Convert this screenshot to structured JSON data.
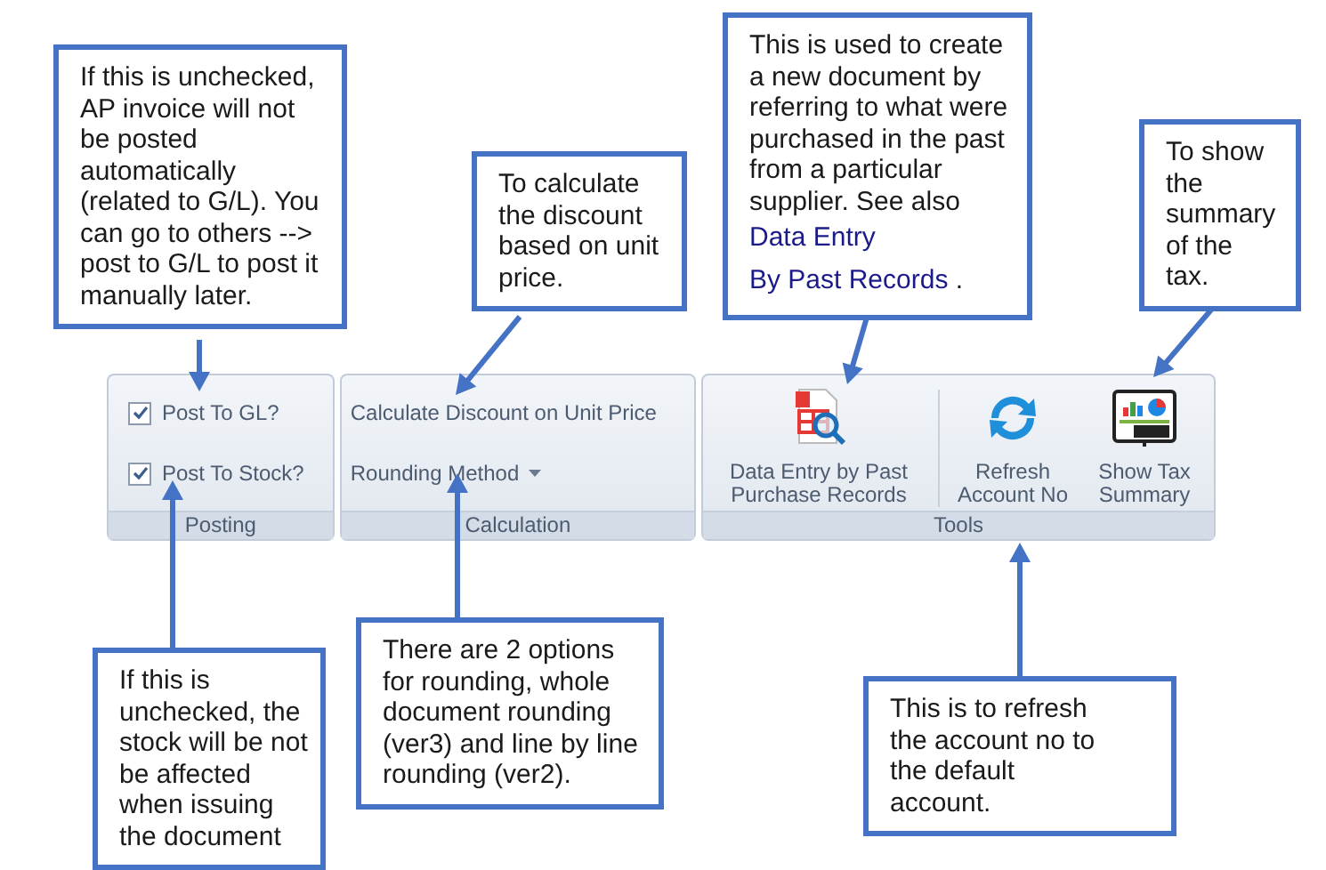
{
  "callouts": [
    {
      "text": "If this is unchecked, AP invoice will not be posted automatically (related to G/L). You can go to others --> post to G/L to post it manually later."
    },
    {
      "text": "To calculate the discount based on unit price."
    },
    {
      "text": "This is used to create a new document by referring to what were purchased in the past from a particular supplier. See also ",
      "links": [
        "Data Entry",
        "By Past Records"
      ],
      "after": " ."
    },
    {
      "text": "To show the summary of the tax."
    },
    {
      "text": "If this is unchecked, the stock will be not be affected when issuing the document"
    },
    {
      "text": "There are 2 options for rounding, whole document rounding (ver3) and line by line rounding (ver2)."
    },
    {
      "text": "This is to refresh the account no to the default account."
    }
  ],
  "ribbon": {
    "groups": [
      {
        "caption": "Posting",
        "items": [
          {
            "kind": "checkbox",
            "label": "Post To GL?",
            "checked": true
          },
          {
            "kind": "checkbox",
            "label": "Post To Stock?",
            "checked": true
          }
        ]
      },
      {
        "caption": "Calculation",
        "items": [
          {
            "kind": "button",
            "label": "Calculate Discount on Unit Price"
          },
          {
            "kind": "dropdown",
            "label": "Rounding Method"
          }
        ]
      },
      {
        "caption": "Tools",
        "items": [
          {
            "kind": "large",
            "label": "Data Entry by Past Purchase Records"
          },
          {
            "kind": "large",
            "label": "Refresh Account No"
          },
          {
            "kind": "large",
            "label": "Show Tax Summary"
          }
        ]
      }
    ]
  }
}
